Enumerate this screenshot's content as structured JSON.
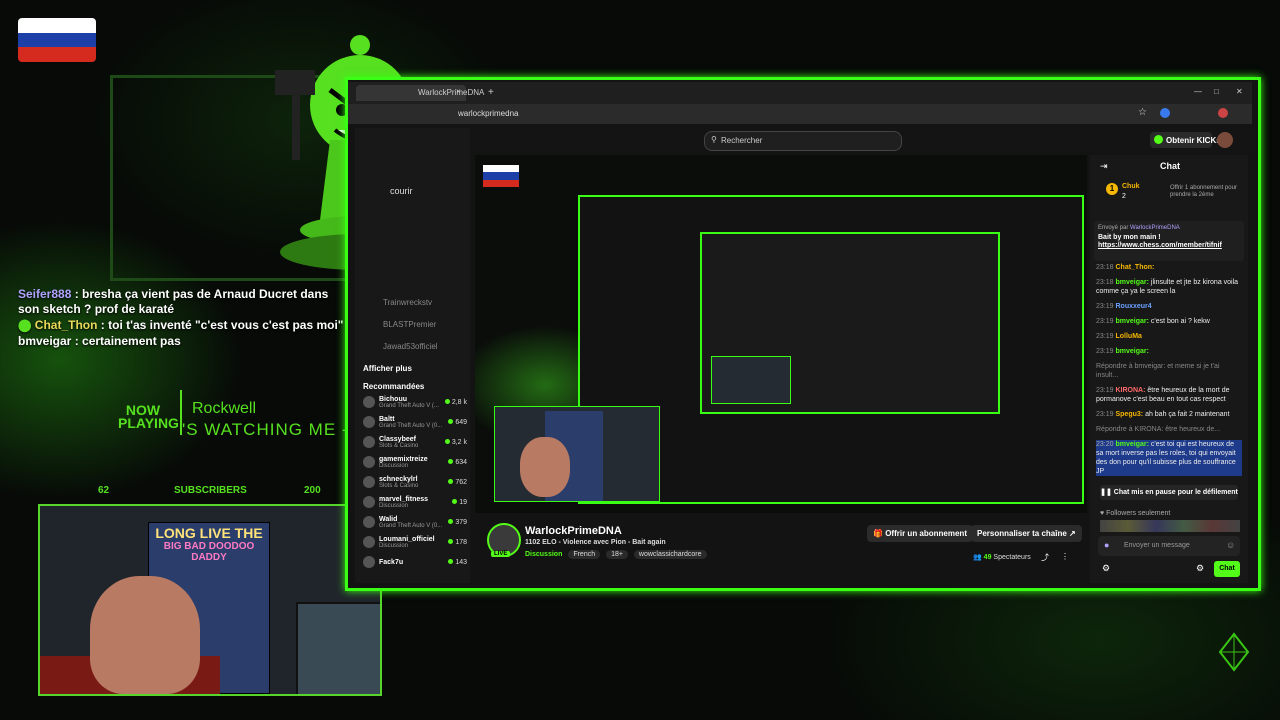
{
  "overlay": {
    "chat": [
      {
        "user": "Seifer888",
        "text": "bresha ça vient pas de Arnaud Ducret dans son sketch ? prof de karaté",
        "color": "#b0a2ff"
      },
      {
        "user": "Chat_Thon",
        "text": "toi t'as inventé \"c'est vous c'est pas moi\"",
        "color": "#e9d85a"
      },
      {
        "user": "bmveigar",
        "text": "certainement pas",
        "color": "#ffffff"
      }
    ],
    "now_playing_label": "NOW PLAYING",
    "artist": "Rockwell",
    "song": "'S WATCHING ME - SIN",
    "subs_left": "62",
    "subs_label": "SUBSCRIBERS",
    "subs_right": "200",
    "poster_line1": "LONG LIVE THE",
    "poster_line2": "BIG BAD DOODOO DADDY"
  },
  "browser": {
    "tab_title": "WarlockPrimeDNA",
    "tab_close": "×",
    "new_tab": "+",
    "url": "warlockprimedna",
    "window_controls": [
      "—",
      "□",
      "✕"
    ]
  },
  "site": {
    "search_placeholder": "Rechercher",
    "kicks_button": "Obtenir KICKs",
    "sidebar": {
      "partial": "courir",
      "followed": [
        "Trainwreckstv",
        "BLASTPremier",
        "Jawad53officiel"
      ],
      "show_more": "Afficher plus",
      "recommended_title": "Recommandées",
      "recommended": [
        {
          "name": "Bichouu",
          "game": "Grand Theft Auto V (...",
          "viewers": "2,8 k"
        },
        {
          "name": "Baltt",
          "game": "Grand Theft Auto V (0...",
          "viewers": "649"
        },
        {
          "name": "Classybeef",
          "game": "Slots & Casino",
          "viewers": "3,2 k"
        },
        {
          "name": "gamemixtreize",
          "game": "Discussion",
          "viewers": "634"
        },
        {
          "name": "schneckylrl",
          "game": "Slots & Casino",
          "viewers": "762"
        },
        {
          "name": "marvel_fitness",
          "game": "Discussion",
          "viewers": "19"
        },
        {
          "name": "Walid",
          "game": "Grand Theft Auto V (0...",
          "viewers": "379"
        },
        {
          "name": "Loumani_officiel",
          "game": "Discussion",
          "viewers": "178"
        },
        {
          "name": "Fack7u",
          "game": "",
          "viewers": "143"
        }
      ]
    },
    "stream": {
      "channel": "WarlockPrimeDNA",
      "title": "1102 ELO - Violence avec Pion - Bait again",
      "category": "Discussion",
      "tags": [
        "French",
        "18+",
        "wowclassichardcore"
      ],
      "live_badge": "LIVE",
      "viewers_count": "49",
      "viewers_label": "Spectateurs",
      "subscribe_button": "Offrir un abonnement",
      "customize_button": "Personnaliser ta chaîne"
    },
    "chat": {
      "title": "Chat",
      "leaderboard_user": "Chuk",
      "leaderboard_count": "2",
      "leaderboard_text": "Offrir 1 abonnement pour prendre la 2ème",
      "pinned_by_label": "Envoyé par",
      "pinned_by": "WarlockPrimeDNA",
      "pinned_text": "Bait by mon main !",
      "pinned_link": "https://www.chess.com/member/tifnif",
      "messages": [
        {
          "time": "23:18",
          "user": "Chat_Thon:",
          "text": ""
        },
        {
          "time": "23:18",
          "user": "bmveigar:",
          "text": "jlinsulte et jte bz kirona voila comme ça ya le screen la"
        },
        {
          "time": "23:19",
          "user": "Rouxxeur4",
          "text": ""
        },
        {
          "time": "23:19",
          "user": "bmveigar:",
          "text": "c'est bon ai ? kekw"
        },
        {
          "time": "23:19",
          "user": "LolluMa",
          "text": ""
        },
        {
          "time": "23:19",
          "user": "bmveigar:",
          "text": ""
        },
        {
          "time": "",
          "user": "",
          "text": "Répondre à bmveigar: et meme si je t'ai insult..."
        },
        {
          "time": "23:19",
          "user": "KIRONA:",
          "text": "être heureux de la mort de pormanove c'est beau en tout cas respect"
        },
        {
          "time": "23:19",
          "user": "Spegu3:",
          "text": "ah bah ça fait 2 maintenant"
        },
        {
          "time": "",
          "user": "",
          "text": "Répondre à KIRONA: être heureux de..."
        },
        {
          "time": "23:20",
          "user": "bmveigar:",
          "text": "c'est toi qui est heureux de sa mort inverse pas les roles, toi qui envoyait des don pour qu'il subisse plus de souffrance JP"
        }
      ],
      "paused_label": "Chat mis en pause pour le défilement",
      "followers_only": "Followers seulement",
      "input_placeholder": "Envoyer un message",
      "send_button": "Chat"
    }
  },
  "colors": {
    "accent": "#53fc18",
    "frame": "#39ff14",
    "bg": "#070a07"
  }
}
